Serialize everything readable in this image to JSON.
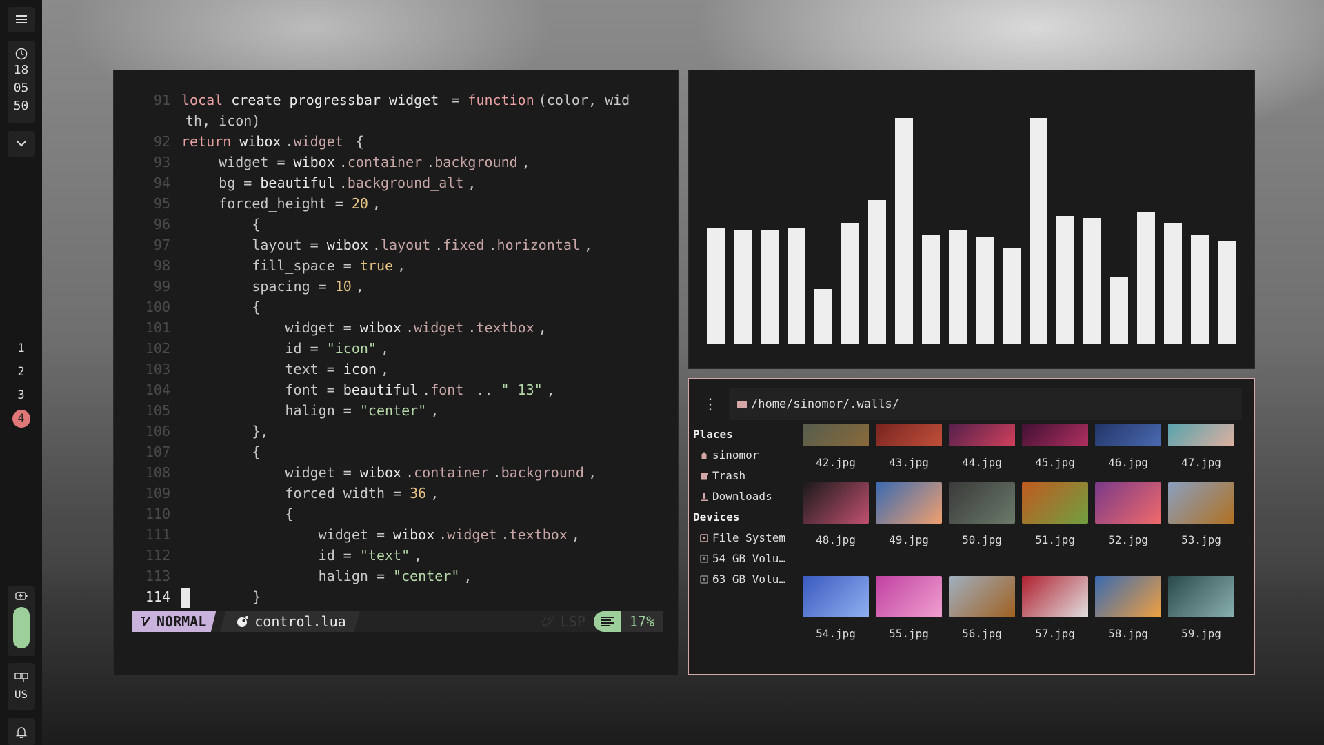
{
  "sidebar": {
    "menu_icon": "hamburger-menu-icon",
    "clock": {
      "hour": "18",
      "minute": "05",
      "second": "50"
    },
    "tags": [
      "1",
      "2",
      "3",
      "4"
    ],
    "active_tag": "4",
    "battery_level": 0.95,
    "keyboard_layout": "US"
  },
  "editor": {
    "lines": [
      {
        "n": "91",
        "tokens": [
          [
            "kw",
            "local "
          ],
          [
            "var",
            "create_progressbar_widget "
          ],
          [
            "txt",
            "= "
          ],
          [
            "kw",
            "function"
          ],
          [
            "txt",
            "(color, wid"
          ]
        ]
      },
      {
        "n": "",
        "tokens": [
          [
            "txt",
            "th, icon)"
          ]
        ]
      },
      {
        "n": "92",
        "tokens": [
          [
            "kw",
            "return "
          ],
          [
            "var",
            "wibox"
          ],
          [
            "txt",
            "."
          ],
          [
            "fld",
            "widget "
          ],
          [
            "txt",
            "{"
          ]
        ]
      },
      {
        "n": "93",
        "tokens": [
          [
            "txt",
            "    widget = "
          ],
          [
            "var",
            "wibox"
          ],
          [
            "txt",
            "."
          ],
          [
            "fld",
            "container"
          ],
          [
            "txt",
            "."
          ],
          [
            "fld",
            "background"
          ],
          [
            "txt",
            ","
          ]
        ]
      },
      {
        "n": "94",
        "tokens": [
          [
            "txt",
            "    bg = "
          ],
          [
            "var",
            "beautiful"
          ],
          [
            "txt",
            "."
          ],
          [
            "fld",
            "background_alt"
          ],
          [
            "txt",
            ","
          ]
        ]
      },
      {
        "n": "95",
        "tokens": [
          [
            "txt",
            "    forced_height = "
          ],
          [
            "num",
            "20"
          ],
          [
            "txt",
            ","
          ]
        ]
      },
      {
        "n": "96",
        "tokens": [
          [
            "txt",
            "        {"
          ]
        ]
      },
      {
        "n": "97",
        "tokens": [
          [
            "txt",
            "        layout = "
          ],
          [
            "var",
            "wibox"
          ],
          [
            "txt",
            "."
          ],
          [
            "fld",
            "layout"
          ],
          [
            "txt",
            "."
          ],
          [
            "fld",
            "fixed"
          ],
          [
            "txt",
            "."
          ],
          [
            "fld",
            "horizontal"
          ],
          [
            "txt",
            ","
          ]
        ]
      },
      {
        "n": "98",
        "tokens": [
          [
            "txt",
            "        fill_space = "
          ],
          [
            "num",
            "true"
          ],
          [
            "txt",
            ","
          ]
        ]
      },
      {
        "n": "99",
        "tokens": [
          [
            "txt",
            "        spacing = "
          ],
          [
            "num",
            "10"
          ],
          [
            "txt",
            ","
          ]
        ]
      },
      {
        "n": "100",
        "tokens": [
          [
            "txt",
            "        {"
          ]
        ]
      },
      {
        "n": "101",
        "tokens": [
          [
            "txt",
            "            widget = "
          ],
          [
            "var",
            "wibox"
          ],
          [
            "txt",
            "."
          ],
          [
            "fld",
            "widget"
          ],
          [
            "txt",
            "."
          ],
          [
            "fld",
            "textbox"
          ],
          [
            "txt",
            ","
          ]
        ]
      },
      {
        "n": "102",
        "tokens": [
          [
            "txt",
            "            id = "
          ],
          [
            "str",
            "\"icon\""
          ],
          [
            "txt",
            ","
          ]
        ]
      },
      {
        "n": "103",
        "tokens": [
          [
            "txt",
            "            text = "
          ],
          [
            "var",
            "icon"
          ],
          [
            "txt",
            ","
          ]
        ]
      },
      {
        "n": "104",
        "tokens": [
          [
            "txt",
            "            font = "
          ],
          [
            "var",
            "beautiful"
          ],
          [
            "txt",
            "."
          ],
          [
            "fld",
            "font "
          ],
          [
            "txt",
            ".. "
          ],
          [
            "str",
            "\" 13\""
          ],
          [
            "txt",
            ","
          ]
        ]
      },
      {
        "n": "105",
        "tokens": [
          [
            "txt",
            "            halign = "
          ],
          [
            "str",
            "\"center\""
          ],
          [
            "txt",
            ","
          ]
        ]
      },
      {
        "n": "106",
        "tokens": [
          [
            "txt",
            "        },"
          ]
        ]
      },
      {
        "n": "107",
        "tokens": [
          [
            "txt",
            "        {"
          ]
        ]
      },
      {
        "n": "108",
        "tokens": [
          [
            "txt",
            "            widget = "
          ],
          [
            "var",
            "wibox"
          ],
          [
            "txt",
            "."
          ],
          [
            "fld",
            "container"
          ],
          [
            "txt",
            "."
          ],
          [
            "fld",
            "background"
          ],
          [
            "txt",
            ","
          ]
        ]
      },
      {
        "n": "109",
        "tokens": [
          [
            "txt",
            "            forced_width = "
          ],
          [
            "num",
            "36"
          ],
          [
            "txt",
            ","
          ]
        ]
      },
      {
        "n": "110",
        "tokens": [
          [
            "txt",
            "            {"
          ]
        ]
      },
      {
        "n": "111",
        "tokens": [
          [
            "txt",
            "                widget = "
          ],
          [
            "var",
            "wibox"
          ],
          [
            "txt",
            "."
          ],
          [
            "fld",
            "widget"
          ],
          [
            "txt",
            "."
          ],
          [
            "fld",
            "textbox"
          ],
          [
            "txt",
            ","
          ]
        ]
      },
      {
        "n": "112",
        "tokens": [
          [
            "txt",
            "                id = "
          ],
          [
            "str",
            "\"text\""
          ],
          [
            "txt",
            ","
          ]
        ]
      },
      {
        "n": "113",
        "tokens": [
          [
            "txt",
            "                halign = "
          ],
          [
            "str",
            "\"center\""
          ],
          [
            "txt",
            ","
          ]
        ]
      },
      {
        "n": "114",
        "tokens": [
          [
            "cursor",
            ""
          ],
          [
            "txt",
            "       }"
          ]
        ],
        "current": true
      }
    ],
    "status": {
      "mode": "NORMAL",
      "filename": "control.lua",
      "lsp": "LSP",
      "percent": "17%"
    }
  },
  "visualizer": {
    "bar_levels": [
      0.51,
      0.5,
      0.5,
      0.51,
      0.24,
      0.53,
      0.63,
      0.99,
      0.48,
      0.5,
      0.47,
      0.42,
      0.99,
      0.56,
      0.55,
      0.29,
      0.58,
      0.53,
      0.48,
      0.45
    ]
  },
  "filemanager": {
    "path": "/home/sinomor/.walls/",
    "places_label": "Places",
    "places": [
      "sinomor",
      "Trash",
      "Downloads"
    ],
    "devices_label": "Devices",
    "devices": [
      "File System",
      "54 GB Volu…",
      "63 GB Volu…"
    ],
    "rows": [
      {
        "files": [
          {
            "name": "42.jpg",
            "c1": "#4a5a52",
            "c2": "#8a6a3a"
          },
          {
            "name": "43.jpg",
            "c1": "#6a1a1a",
            "c2": "#c0503a"
          },
          {
            "name": "44.jpg",
            "c1": "#3a1a4a",
            "c2": "#d0405a"
          },
          {
            "name": "45.jpg",
            "c1": "#2a0a2a",
            "c2": "#b03060"
          },
          {
            "name": "46.jpg",
            "c1": "#1a2a5a",
            "c2": "#4a6ab0"
          },
          {
            "name": "47.jpg",
            "c1": "#3aa0b0",
            "c2": "#e0b0a0"
          }
        ]
      },
      {
        "files": [
          {
            "name": "48.jpg",
            "c1": "#1a1a1a",
            "c2": "#c05070"
          },
          {
            "name": "49.jpg",
            "c1": "#3a6ab0",
            "c2": "#f0a070"
          },
          {
            "name": "50.jpg",
            "c1": "#3a3a3a",
            "c2": "#6a7a6a"
          },
          {
            "name": "51.jpg",
            "c1": "#c05a20",
            "c2": "#70a040"
          },
          {
            "name": "52.jpg",
            "c1": "#7a3a8a",
            "c2": "#f06a6a"
          },
          {
            "name": "53.jpg",
            "c1": "#8aa0c0",
            "c2": "#b07020"
          }
        ]
      },
      {
        "files": [
          {
            "name": "54.jpg",
            "c1": "#3a5ac0",
            "c2": "#90b0f0"
          },
          {
            "name": "55.jpg",
            "c1": "#c040a0",
            "c2": "#f0a0d0"
          },
          {
            "name": "56.jpg",
            "c1": "#a0b0c0",
            "c2": "#a06020"
          },
          {
            "name": "57.jpg",
            "c1": "#b02030",
            "c2": "#e0e0e0"
          },
          {
            "name": "58.jpg",
            "c1": "#3a6ab0",
            "c2": "#f0a040"
          },
          {
            "name": "59.jpg",
            "c1": "#2a4a4a",
            "c2": "#8ab0b0"
          }
        ]
      }
    ]
  }
}
